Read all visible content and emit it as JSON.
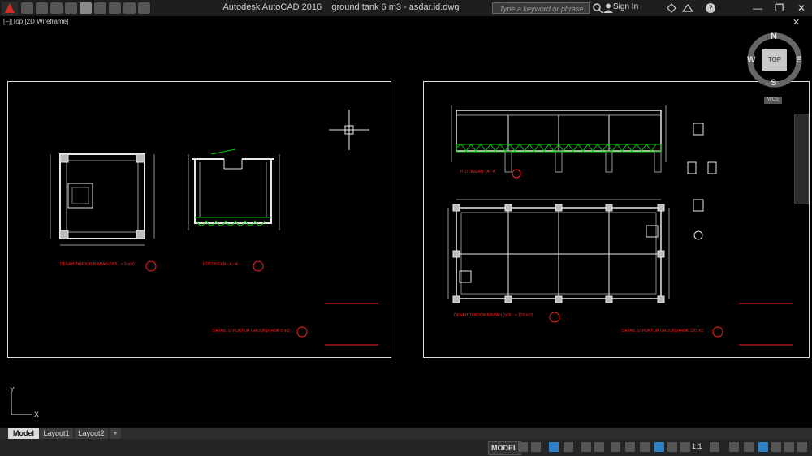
{
  "titlebar": {
    "app_name": "Autodesk AutoCAD 2016",
    "file_name": "ground tank 6 m3 - asdar.id.dwg",
    "search_placeholder": "Type a keyword or phrase",
    "signin_label": "Sign In",
    "minimize": "—",
    "restore": "❐",
    "close": "✕"
  },
  "viewport": {
    "label": "[−][Top][2D Wireframe]",
    "close_glyph": "✕"
  },
  "viewcube": {
    "north": "N",
    "south": "S",
    "east": "E",
    "west": "W",
    "top": "TOP",
    "wcs": "WCS"
  },
  "ucs": {
    "x": "X",
    "y": "Y"
  },
  "drawing": {
    "sheet1_plan_title": "DENAH TANDON BAWAH (VOL. = 6 m3)",
    "sheet1_section_title": "POTONGAN : A - A",
    "sheet1_detail_title": "DETAIL STRUKTUR GROUNDTANK 6 m3",
    "sheet2_section_title": "POTONGAN : A - A",
    "sheet2_plan_title": "DENAH TANDON BAWAH (VOL. = 120 m3)",
    "sheet2_detail_title": "DETAIL STRUKTUR GROUNDTANK 120 m3",
    "section_mark": "A"
  },
  "layout_tabs": {
    "model": "Model",
    "layout1": "Layout1",
    "layout2": "Layout2",
    "add": "+"
  },
  "statusbar": {
    "model": "MODEL",
    "scale": "1:1"
  },
  "colors": {
    "linework": "#ffffff",
    "labels": "#ff2020",
    "rebar": "#00c800",
    "background": "#000000"
  }
}
